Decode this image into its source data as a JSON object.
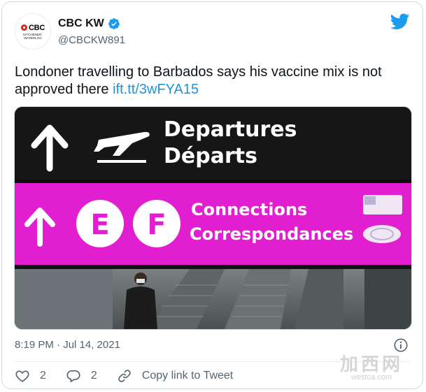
{
  "account": {
    "display_name": "CBC KW",
    "handle": "@CBCKW891",
    "avatar_brand": "CBC",
    "avatar_sub_line1": "KITCHENER-",
    "avatar_sub_line2": "WATERLOO",
    "verified": true
  },
  "tweet": {
    "text": "Londoner travelling to Barbados says his vaccine mix is not approved there ",
    "link": "ift.tt/3wFYA15",
    "timestamp": "8:19 PM · Jul 14, 2021"
  },
  "media": {
    "sign_top_line1": "Departures",
    "sign_top_line2": "Départs",
    "sign_letter_e": "E",
    "sign_letter_f": "F",
    "sign_mid_line1": "Connections",
    "sign_mid_line2": "Correspondances"
  },
  "actions": {
    "like_count": "2",
    "reply_count": "2",
    "copy_link_label": "Copy link to Tweet"
  },
  "watermark": {
    "cn": "加西网",
    "en": "westca.com"
  },
  "colors": {
    "accent": "#1d9bf0",
    "link": "#1b95e0",
    "sign_magenta": "#e21fd0",
    "text_secondary": "#536471"
  }
}
